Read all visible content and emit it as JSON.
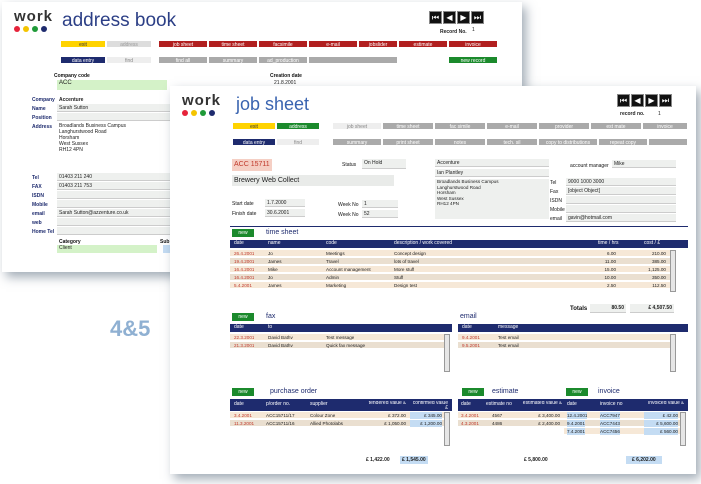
{
  "address_book": {
    "logo": "work",
    "title": "address book",
    "record_label": "Record No.",
    "record_no": "1",
    "tabs_left": [
      "exit",
      "address",
      "data entry",
      "find"
    ],
    "tabs_main": [
      "job sheet",
      "time sheet",
      "facsimile",
      "e-mail",
      "jobslider",
      "estimate",
      "invoice"
    ],
    "tabs_sub": [
      "find all",
      "summary",
      "ad_production"
    ],
    "new_record": "new record",
    "company_code_label": "Company code",
    "company_code": "ACC",
    "creation_date_label": "Creation date",
    "creation_date": "21.8.2001",
    "labels": [
      "Company",
      "Name",
      "Position",
      "Address",
      "Tel",
      "FAX",
      "ISDN",
      "Mobile",
      "email",
      "web",
      "Home Tel"
    ],
    "company": "Accenture",
    "name": "Sarah Sutton",
    "address_lines": [
      "Broadlands Business Campus",
      "Langhurstwood Road",
      "Horsham",
      "West Sussex",
      "RH12 4PN"
    ],
    "tel": "01403 211 240",
    "fax": "01403 211 753",
    "email": "Sarah Sutton@azzenture.co.uk",
    "category_label": "Category",
    "category": "Client",
    "sub_label": "Sub c"
  },
  "caption": "4&5",
  "job_sheet": {
    "logo": "work",
    "title": "job sheet",
    "record_label": "record no.",
    "record_no": "1",
    "tabs_left": [
      "exit",
      "address",
      "data entry",
      "find"
    ],
    "tabs_main": [
      "job sheet",
      "time sheet",
      "fac simile",
      "e-mail",
      "provider",
      "est mate",
      "invoice"
    ],
    "tabs_sub": [
      "summary",
      "print sheet",
      "notes",
      "tech. sil",
      "copy to distributions",
      "repeat copy"
    ],
    "job_code": "ACC 15711",
    "job_name": "Brewery Web Collect",
    "status_label": "Status",
    "status": "On Hold",
    "start_label": "Start date",
    "start_date": "1.7.2000",
    "finish_label": "Finish date",
    "finish_date": "30.6.2001",
    "weekno_label": "Week No",
    "week_start": "1",
    "week_finish": "52",
    "client": "Accenture",
    "contact": "Ian Plantley",
    "address_lines": [
      "Broadlands Business Campus",
      "Langhurstwood Road",
      "Horsham",
      "West Sussex",
      "RH12 4PN"
    ],
    "account_manager_label": "account manager",
    "account_manager": "Mike",
    "contact_labels": [
      "Tel",
      "Fax",
      "ISDN",
      "Mobile",
      "email"
    ],
    "tel": "9000 1000 3000",
    "fax": {
      "title": "fax",
      "headers": [
        "date",
        "to"
      ],
      "rows": [
        [
          "22.3.2001",
          "David Bathv",
          "Test message"
        ],
        [
          "21.3.2001",
          "David Bathv",
          "Quick fax message"
        ]
      ]
    },
    "email": "gavin@hotmail.com",
    "new_label": "new",
    "timesheet": {
      "title": "time sheet",
      "headers": [
        "date",
        "name",
        "code",
        "description / work covered",
        "time / hrs",
        "cost / £"
      ],
      "rows": [
        [
          "26.4.2001",
          "Jo",
          "Meetings",
          "Concept design",
          "6.00",
          "210.00"
        ],
        [
          "19.4.2001",
          "James",
          "Travel",
          "lots of travel",
          "11.00",
          "385.00"
        ],
        [
          "16.4.2001",
          "Mike",
          "Account management",
          "More stuff",
          "15.00",
          "1,125.00"
        ],
        [
          "16.4.2001",
          "Jo",
          "Admin",
          "Stuff",
          "10.00",
          "350.00"
        ],
        [
          "5.4.2001",
          "James",
          "Marketing",
          "Design test",
          "2.50",
          "112.50"
        ]
      ],
      "totals_label": "Totals",
      "total_hours": "80.50",
      "total_cost": "£ 4,507.50"
    },
    "email_section": {
      "title": "email",
      "headers": [
        "date",
        "message"
      ],
      "rows": [
        [
          "9.4.2001",
          "Test email"
        ],
        [
          "9.5.2001",
          "Test email"
        ]
      ]
    },
    "purchase": {
      "title": "purchase order",
      "headers": [
        "date",
        "p/order no.",
        "supplier",
        "tendered value £",
        "confirmed value £"
      ],
      "rows": [
        [
          "3.4.2001",
          "ACC15711/17",
          "Colour Zone",
          "£ 372.00",
          "£ 345.00"
        ],
        [
          "11.3.2001",
          "ACC15711/16",
          "Allied Photolabs",
          "£ 1,050.00",
          "£ 1,200.00"
        ]
      ],
      "total_tendered": "£ 1,422.00",
      "total_confirmed": "£ 1,545.00"
    },
    "estimate": {
      "title": "estimate",
      "headers": [
        "date",
        "estimate no",
        "estimated value £"
      ],
      "rows": [
        [
          "3.4.2001",
          "4567",
          "£ 3,400.00"
        ],
        [
          "4.3.2001",
          "4486",
          "£ 2,400.00"
        ]
      ],
      "total": "£ 5,800.00"
    },
    "invoice": {
      "title": "invoice",
      "headers": [
        "date",
        "invoice no",
        "invoiced value £"
      ],
      "rows": [
        [
          "12.4.2001",
          "ACC7947",
          "£ 42.00"
        ],
        [
          "9.4.2001",
          "ACC7443",
          "£ 5,600.00"
        ],
        [
          "7.4.2001",
          "ACC7456",
          "£ 560.00"
        ]
      ],
      "total": "£ 6,202.00"
    }
  }
}
